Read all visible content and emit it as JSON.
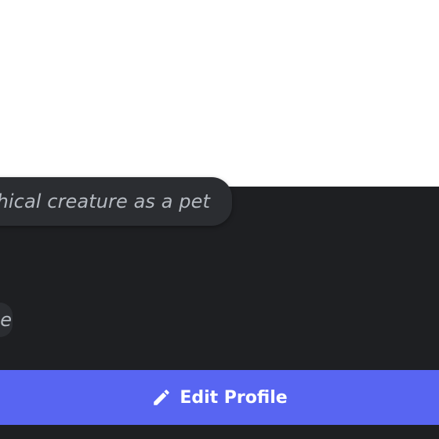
{
  "profile": {
    "status_text": "thical creature as a pet",
    "second_status_text": "e"
  },
  "actions": {
    "edit_profile_label": "Edit Profile",
    "edit_profile_icon": "pencil-icon"
  },
  "colors": {
    "background_dark": "#1e1f22",
    "pill_background": "#2b2d31",
    "accent": "#5865f2",
    "muted_text": "#b5bac1"
  }
}
